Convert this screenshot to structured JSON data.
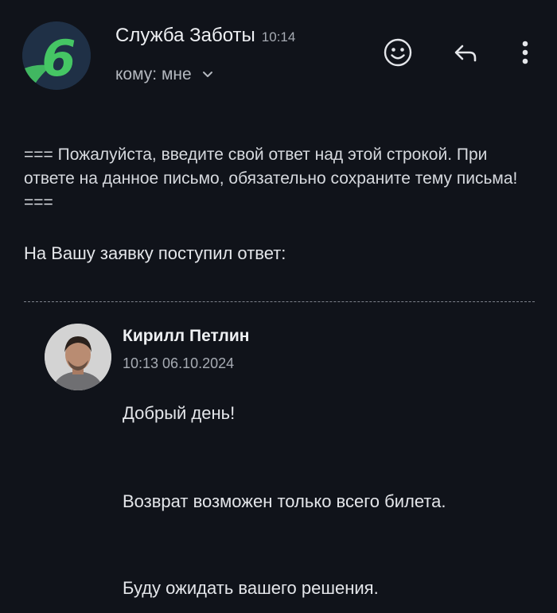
{
  "header": {
    "sender_name": "Служба Заботы",
    "time": "10:14",
    "recipient": "кому: мне",
    "logo_char": "6"
  },
  "icons": {
    "emoji": "smile-icon",
    "reply": "reply-icon",
    "more": "more-vertical-icon",
    "recipient_toggle": "chevron-down-icon"
  },
  "body": {
    "notice": "=== Пожалуйста, введите свой ответ над этой строкой. При ответе на данное письмо, обязательно сохраните тему письма! ===",
    "intro": "На Вашу заявку поступил ответ:"
  },
  "reply": {
    "author": "Кирилл Петлин",
    "datetime": "10:13 06.10.2024",
    "messages": [
      "Добрый день!",
      "Возврат возможен только всего билета.",
      "Буду ожидать вашего решения."
    ]
  },
  "colors": {
    "background": "#10131a",
    "brand_green": "#45c664",
    "logo_bg": "#1f3046"
  }
}
